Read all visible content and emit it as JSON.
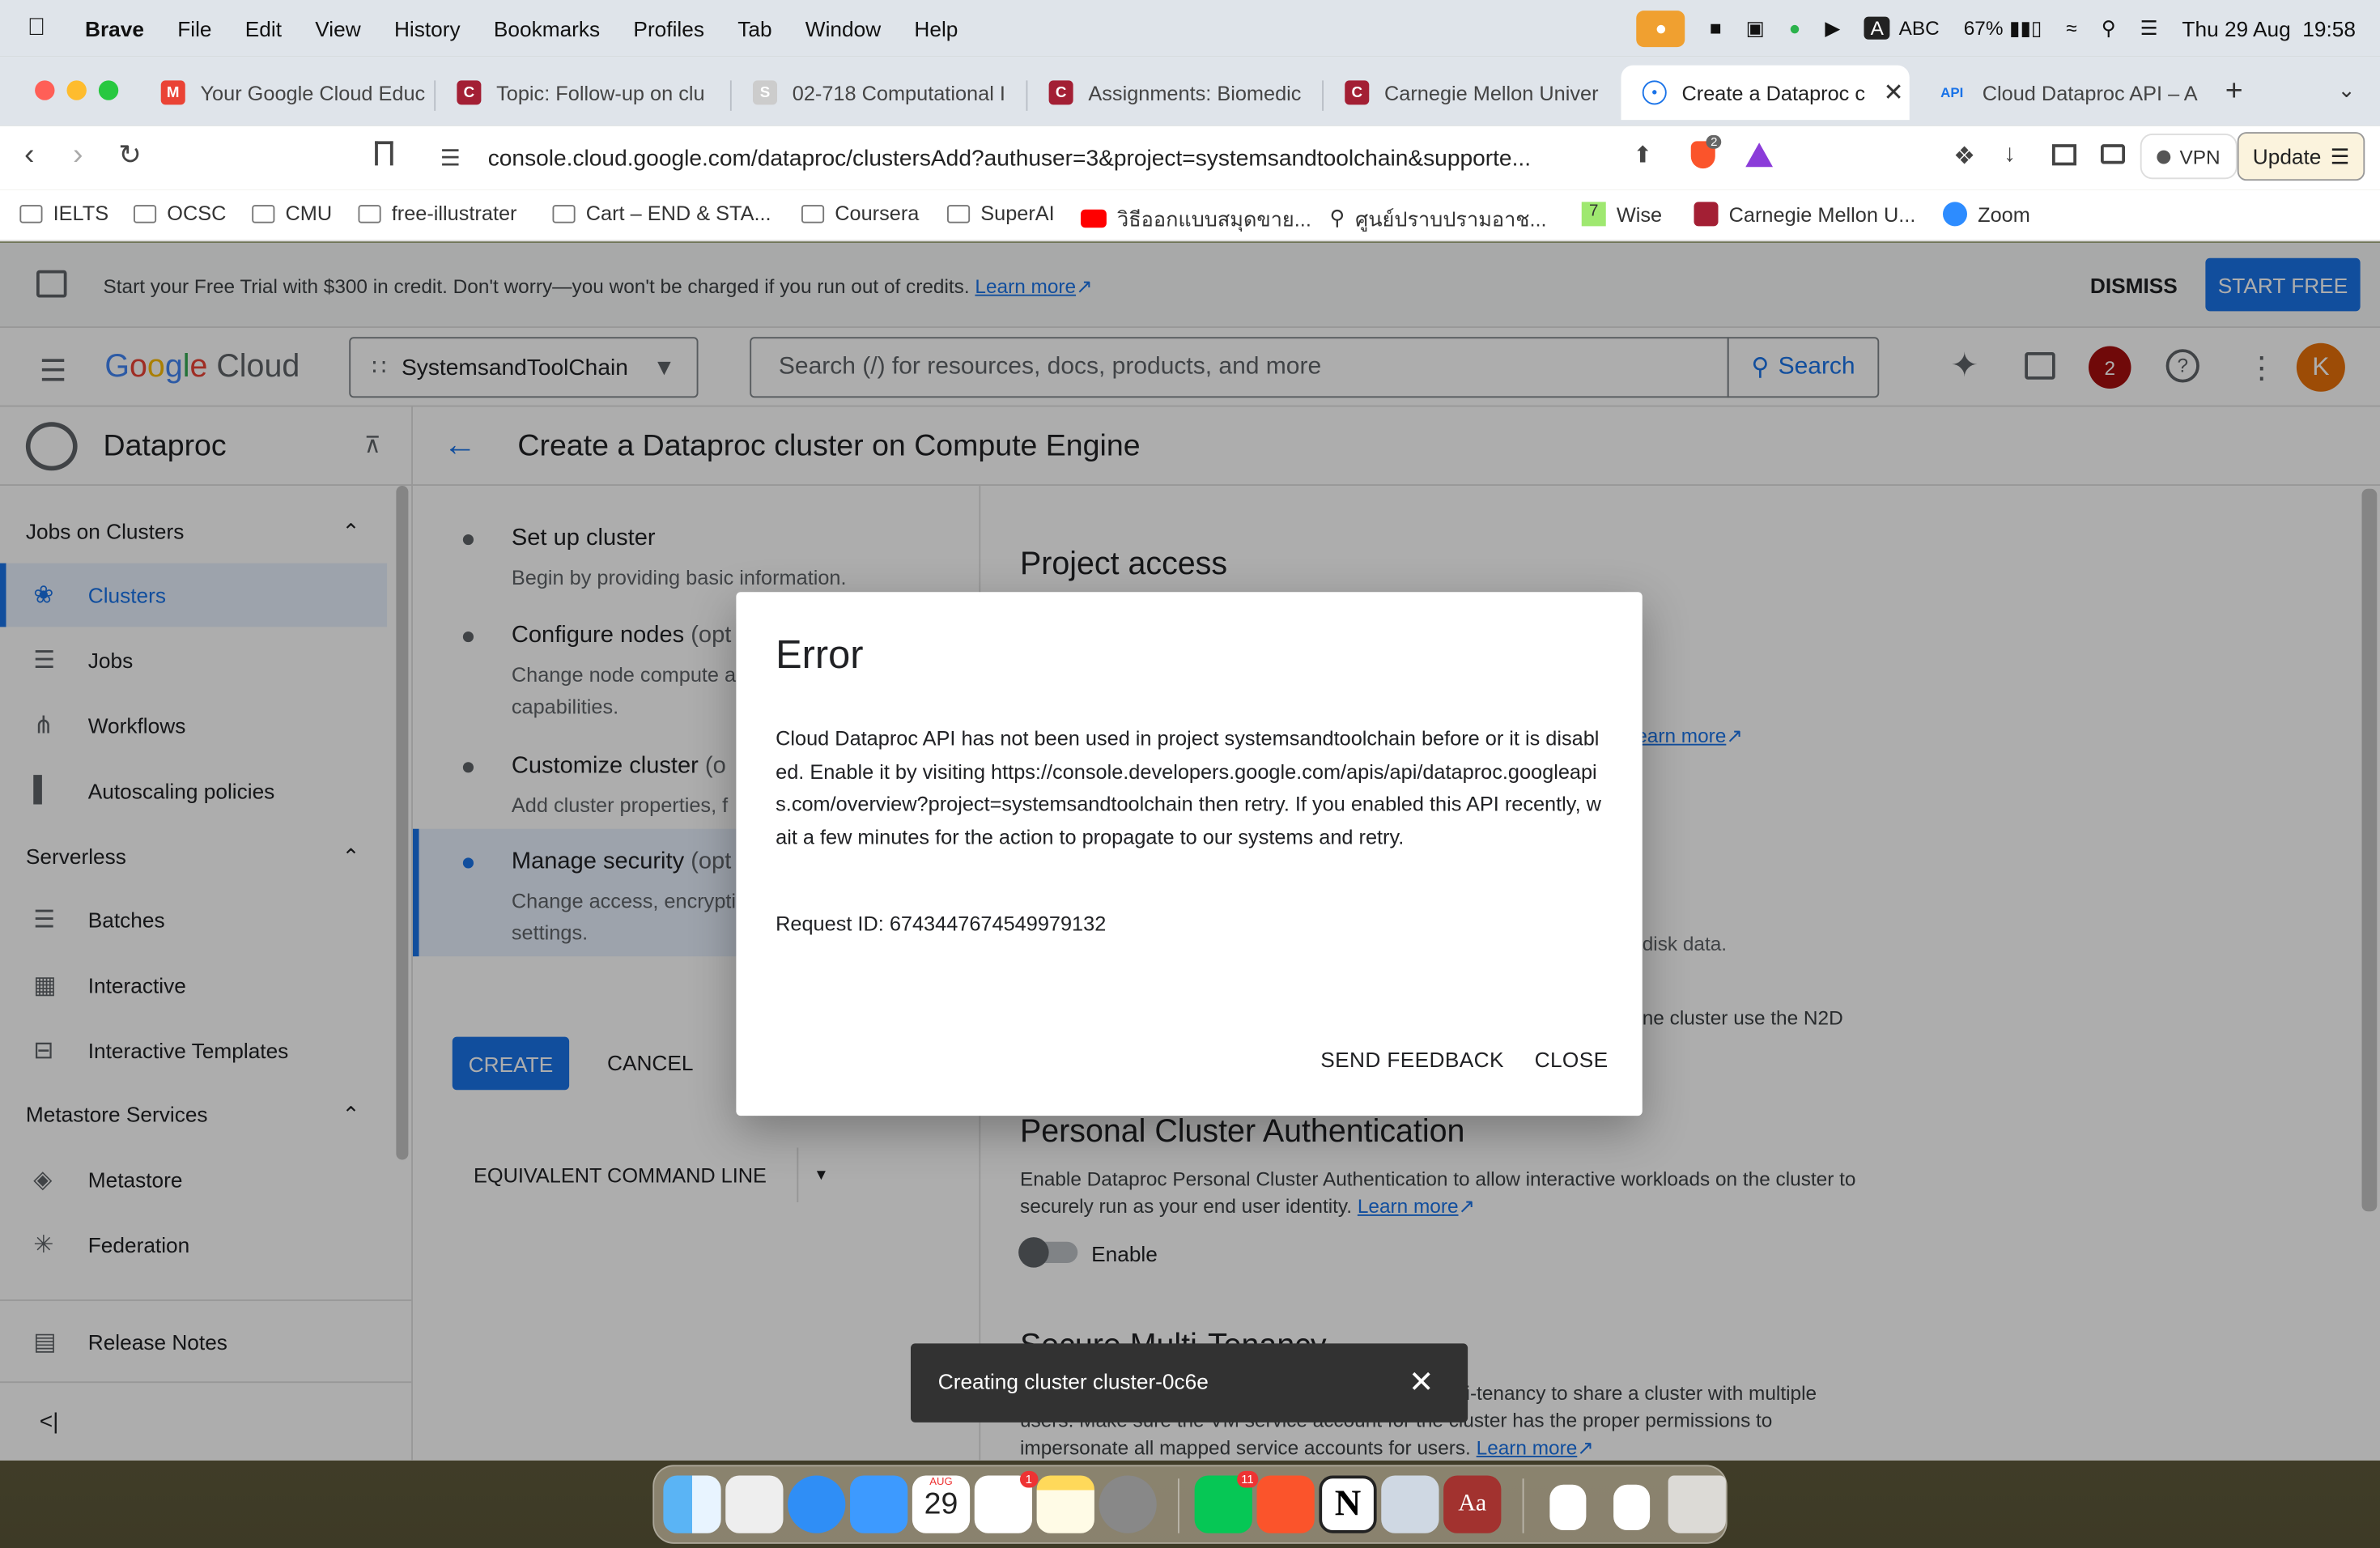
{
  "menubar": {
    "app": "Brave",
    "items": [
      "File",
      "Edit",
      "View",
      "History",
      "Bookmarks",
      "Profiles",
      "Tab",
      "Window",
      "Help"
    ],
    "battery": "67%",
    "input_method": "ABC",
    "datetime": "Thu 29 Aug  19:58"
  },
  "tabs": [
    {
      "title": "Your Google Cloud Educ",
      "favicon": "gmail-icon"
    },
    {
      "title": "Topic: Follow-up on clu",
      "favicon": "cmu-icon"
    },
    {
      "title": "02-718 Computational I",
      "favicon": "s-icon"
    },
    {
      "title": "Assignments: Biomedic",
      "favicon": "cmu-icon"
    },
    {
      "title": "Carnegie Mellon Univer",
      "favicon": "cmu-icon"
    },
    {
      "title": "Create a Dataproc c",
      "favicon": "dataproc-icon"
    },
    {
      "title": "Cloud Dataproc API – A",
      "favicon": "api-icon"
    }
  ],
  "address": {
    "url": "console.cloud.google.com/dataproc/clustersAdd?authuser=3&project=systemsandtoolchain&supporte...",
    "vpn": "VPN",
    "update": "Update",
    "brave_badge": "2"
  },
  "bookmarks": [
    "IELTS",
    "OCSC",
    "CMU",
    "free-illustrater",
    "Cart – END & STA...",
    "Coursera",
    "SuperAI",
    "วิธีออกแบบสมุดขาย...",
    "ศูนย์ปราบปรามอาช...",
    "Wise",
    "Carnegie Mellon U...",
    "Zoom"
  ],
  "banner": {
    "text": "Start your Free Trial with $300 in credit. Don't worry—you won't be charged if you run out of credits.",
    "learn_more": "Learn more",
    "dismiss": "DISMISS",
    "start_free": "START FREE"
  },
  "gcbar": {
    "logo": "Google Cloud",
    "project": "SystemsandToolChain",
    "search_placeholder": "Search (/) for resources, docs, products, and more",
    "search_button": "Search",
    "notifications": "2",
    "avatar": "K"
  },
  "sidebar": {
    "product": "Dataproc",
    "sections": [
      {
        "title": "Jobs on Clusters",
        "items": [
          "Clusters",
          "Jobs",
          "Workflows",
          "Autoscaling policies"
        ]
      },
      {
        "title": "Serverless",
        "items": [
          "Batches",
          "Interactive",
          "Interactive Templates"
        ]
      },
      {
        "title": "Metastore Services",
        "items": [
          "Metastore",
          "Federation"
        ]
      }
    ],
    "release_notes": "Release Notes"
  },
  "page": {
    "title": "Create a Dataproc cluster on Compute Engine",
    "steps": [
      {
        "title": "Set up cluster",
        "opt": "",
        "desc": "Begin by providing basic information."
      },
      {
        "title": "Configure nodes",
        "opt": " (opt",
        "desc": "Change node compute a capabilities."
      },
      {
        "title": "Customize cluster",
        "opt": " (o",
        "desc": "Add cluster properties, f"
      },
      {
        "title": "Manage security",
        "opt": " (opt",
        "desc": "Change access, encrypti settings."
      }
    ],
    "create": "CREATE",
    "cancel": "CANCEL",
    "equivalent": "EQUIVALENT COMMAND LINE",
    "right": {
      "project_access": "Project access",
      "learn_more": "earn more",
      "disk_data": "disk data.",
      "n2d": "ne cluster use the N2D",
      "pca_title": "Personal Cluster Authentication",
      "pca_desc": "Enable Dataproc Personal Cluster Authentication to allow interactive workloads on the cluster to securely run as your end user identity.",
      "pca_learn": "Learn more",
      "enable": "Enable",
      "smt_title": "Secure Multi-Tenancy",
      "smt_desc1": "ti-tenancy to share a cluster with multiple",
      "smt_desc2": "users. Make sure the VM service account for the cluster has the proper permissions to",
      "smt_desc3": "impersonate all mapped service accounts for users.",
      "smt_learn": "Learn more"
    }
  },
  "dialog": {
    "title": "Error",
    "message": "Cloud Dataproc API has not been used in project systemsandtoolchain before or it is disabled. Enable it by visiting https://console.developers.google.com/apis/api/dataproc.googleapis.com/overview?project=systemsandtoolchain then retry. If you enabled this API recently, wait a few minutes for the action to propagate to our systems and retry.",
    "request_id": "Request ID: 6743447674549979132",
    "send_feedback": "SEND FEEDBACK",
    "close": "CLOSE"
  },
  "toast": {
    "text": "Creating cluster cluster-0c6e"
  },
  "dock": {
    "calendar_month": "AUG",
    "calendar_day": "29",
    "reminders_badge": "1",
    "line_badge": "11"
  }
}
